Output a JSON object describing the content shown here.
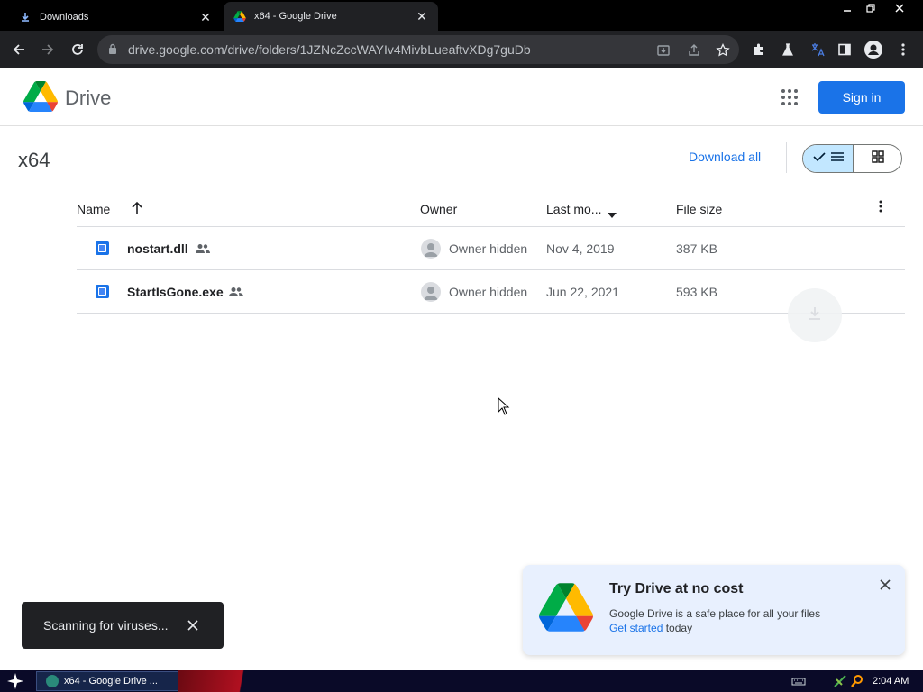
{
  "browser": {
    "tabs": [
      {
        "title": "Downloads"
      },
      {
        "title": "x64 - Google Drive"
      }
    ],
    "url": "drive.google.com/drive/folders/1JZNcZccWAYIv4MivbLueaftvXDg7guDb"
  },
  "header": {
    "brand": "Drive",
    "signin_label": "Sign in"
  },
  "folder": {
    "title": "x64",
    "download_all_label": "Download all"
  },
  "table": {
    "columns": {
      "name": "Name",
      "owner": "Owner",
      "modified": "Last mo...",
      "size": "File size"
    },
    "rows": [
      {
        "name": "nostart.dll",
        "owner": "Owner hidden",
        "modified": "Nov 4, 2019",
        "size": "387 KB"
      },
      {
        "name": "StartIsGone.exe",
        "owner": "Owner hidden",
        "modified": "Jun 22, 2021",
        "size": "593 KB"
      }
    ]
  },
  "snackbar": {
    "message": "Scanning for viruses..."
  },
  "promo": {
    "title": "Try Drive at no cost",
    "body": "Google Drive is a safe place for all your files",
    "link": "Get started",
    "suffix": " today"
  },
  "taskbar": {
    "window_title": "x64 - Google Drive ...",
    "clock": "2:04 AM"
  },
  "colors": {
    "accent": "#1a73e8",
    "toggle_active": "#c2e7ff",
    "promo_bg": "#e8f0fe"
  }
}
